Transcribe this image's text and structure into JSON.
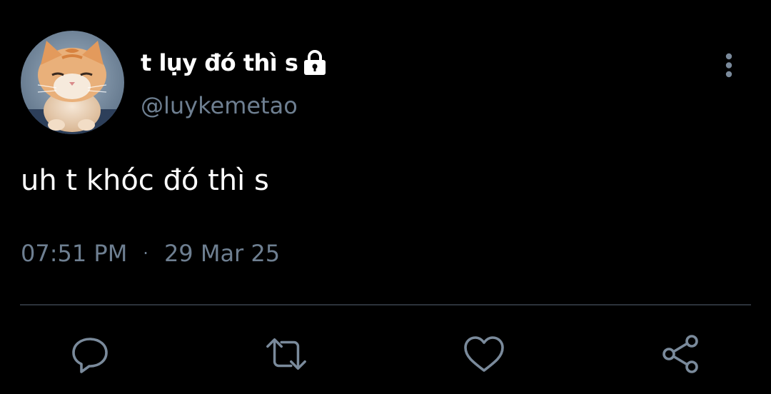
{
  "tweet": {
    "author": {
      "display_name": "t lụy đó thì s",
      "handle": "@luykemetao",
      "protected_icon": "lock-icon",
      "avatar": "avatar-orange-kitten"
    },
    "text": "uh t khóc đó thì s",
    "time": "07:51 PM",
    "separator": "·",
    "date": "29 Mar 25",
    "menu_icon": "more-vertical-icon"
  },
  "actions": [
    {
      "name": "reply",
      "icon": "comment-icon"
    },
    {
      "name": "retweet",
      "icon": "retweet-icon"
    },
    {
      "name": "like",
      "icon": "heart-icon"
    },
    {
      "name": "share",
      "icon": "share-icon"
    }
  ],
  "colors": {
    "background": "#000000",
    "text_primary": "#ffffff",
    "text_secondary": "#6e7f91",
    "divider": "#2c333b",
    "icon": "#7a8a9b"
  }
}
